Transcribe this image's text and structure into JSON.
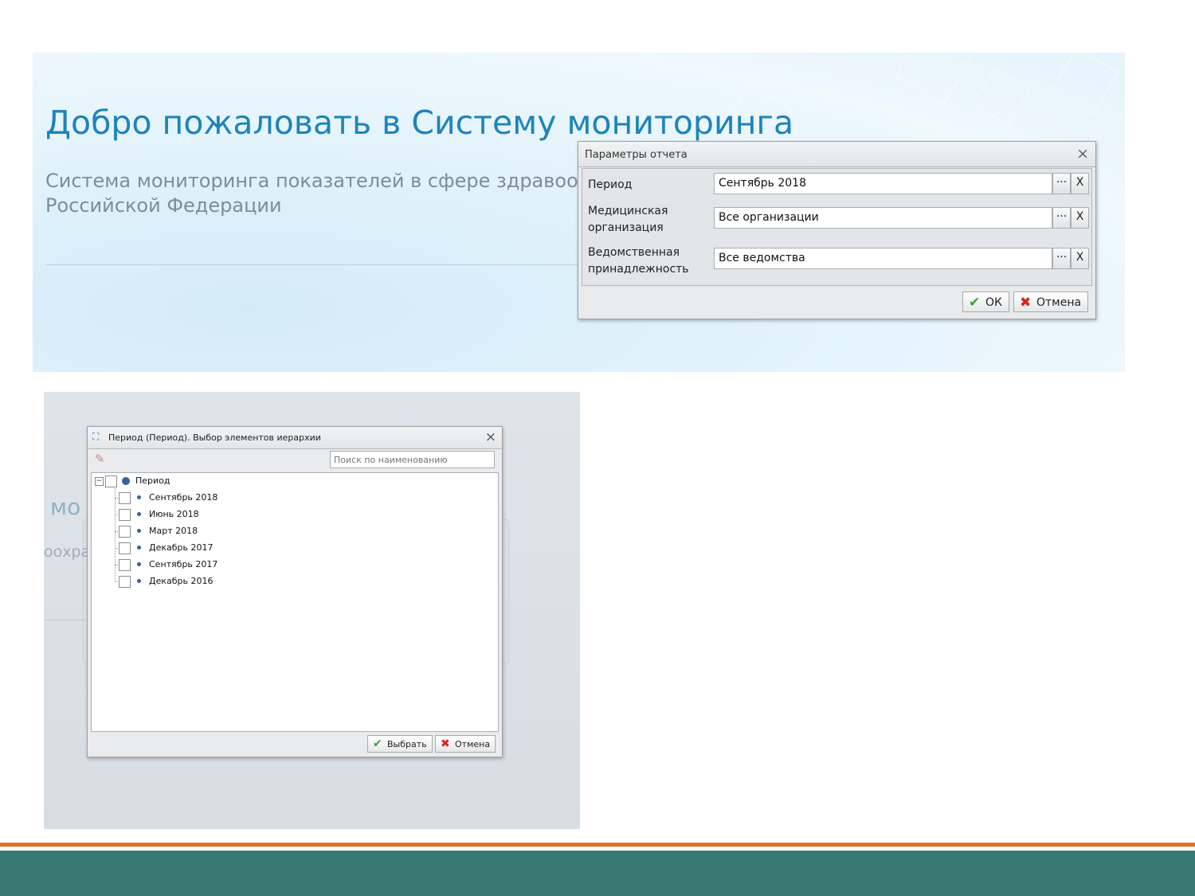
{
  "banner": {
    "title": "Добро пожаловать в Систему мониторинга",
    "subtitle_line1": "Система мониторинга показателей в сфере здравоохранения",
    "subtitle_line2": "Российской Федерации"
  },
  "params_dialog": {
    "title": "Параметры отчета",
    "rows": [
      {
        "label_line1": "Период",
        "label_line2": "",
        "value": "Сентябрь 2018"
      },
      {
        "label_line1": "Медицинская",
        "label_line2": "организация",
        "value": "Все организации"
      },
      {
        "label_line1": "Ведомственная",
        "label_line2": "принадлежность",
        "value": "Все ведомства"
      }
    ],
    "ellipsis_label": "···",
    "clear_label": "X",
    "ok_label": "ОК",
    "cancel_label": "Отмена"
  },
  "background_fragments": {
    "text1": "мо",
    "text2": "оохра"
  },
  "hierarchy_dialog": {
    "title": "Период (Период). Выбор элементов иерархии",
    "search_placeholder": "Поиск по наименованию",
    "expander_label": "−",
    "root": {
      "label": "Период"
    },
    "items": [
      {
        "label": "Сентябрь 2018"
      },
      {
        "label": "Июнь 2018"
      },
      {
        "label": "Март 2018"
      },
      {
        "label": "Декабрь 2017"
      },
      {
        "label": "Сентябрь 2017"
      },
      {
        "label": "Декабрь 2016"
      }
    ],
    "select_label": "Выбрать",
    "cancel_label": "Отмена"
  },
  "icons": {
    "close": "×",
    "ok": "✔",
    "cancel": "✖",
    "eraser": "✎",
    "hierarchy": "⛶"
  },
  "colors": {
    "title_blue": "#1e84b8",
    "accent_orange": "#e2702c",
    "footer_teal": "#367a73",
    "ok_green": "#3aa234",
    "cancel_red": "#d9251d"
  }
}
